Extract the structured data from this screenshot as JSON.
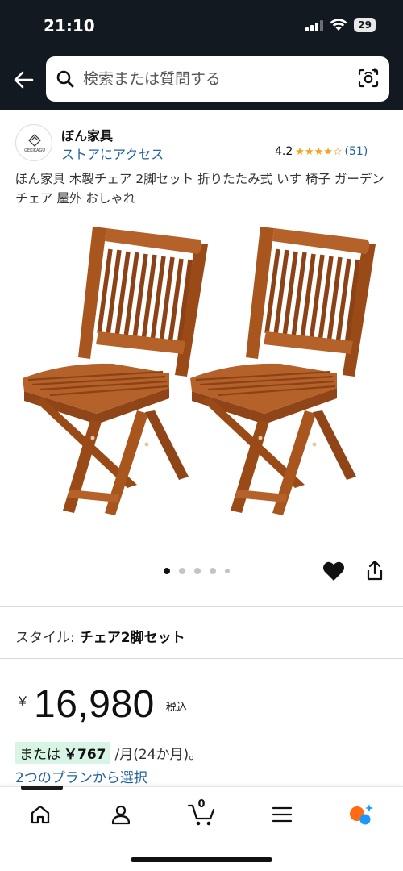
{
  "status_bar": {
    "time": "21:10",
    "battery": "29"
  },
  "search": {
    "placeholder": "検索または質問する"
  },
  "store": {
    "logo_text": "GEKIKAGU",
    "name": "ぼん家具",
    "link": "ストアにアクセス"
  },
  "rating": {
    "score": "4.2",
    "stars": 4.2,
    "count": "(51)"
  },
  "product": {
    "title": "ぼん家具 木製チェア 2脚セット 折りたたみ式 いす 椅子 ガーデンチェア 屋外 おしゃれ"
  },
  "carousel": {
    "total": 5,
    "active_index": 0
  },
  "style": {
    "label": "スタイル:",
    "value": "チェア2脚セット"
  },
  "price": {
    "currency": "￥",
    "value": "16,980",
    "tax": "税込"
  },
  "installment": {
    "prefix": "または",
    "amount": "￥767",
    "term": "/月(24か月)。"
  },
  "plans_link": "2つのプランから選択",
  "bottom_nav": {
    "cart_count": "0",
    "items": [
      "home-icon",
      "account-icon",
      "cart-icon",
      "menu-icon",
      "ai-assistant-icon"
    ]
  },
  "colors": {
    "header_bg": "#131921",
    "link": "#2162a1",
    "star": "#f4a41c",
    "installment_bg": "#d7f4e5",
    "wood": "#a8551e"
  }
}
